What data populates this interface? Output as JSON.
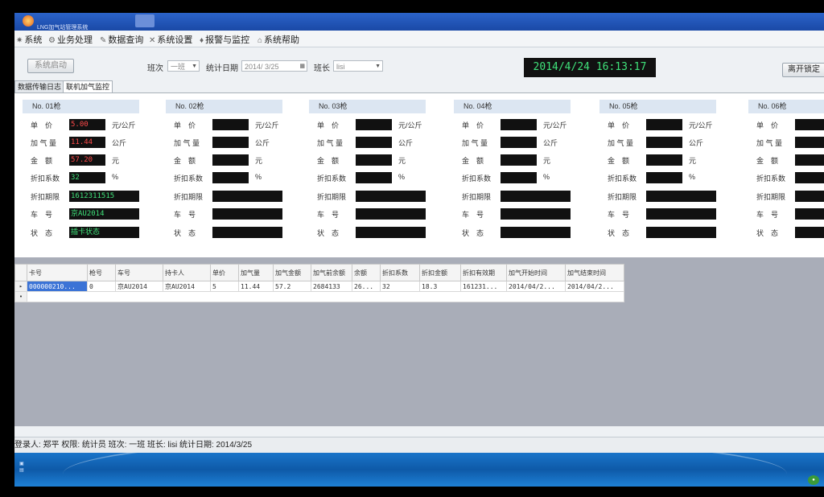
{
  "window": {
    "title": "LNG加气站管理系统"
  },
  "menu": [
    "系统",
    "业务处理",
    "数据查询",
    "系统设置",
    "报警与监控",
    "系统帮助"
  ],
  "menu_icons": [
    "gear-icon",
    "briefcase-icon",
    "search-icon",
    "tools-icon",
    "alarm-icon",
    "help-icon"
  ],
  "toolbar": {
    "start_button": "系统启动",
    "shift_label": "班次",
    "shift_value": "一班",
    "date_label": "统计日期",
    "date_value": "2014/ 3/25",
    "leader_label": "班长",
    "leader_value": "lisi",
    "clock": "2014/4/24  16:13:17",
    "unlock_button": "离开锁定"
  },
  "tabs": [
    "数据传输日志",
    "联机加气监控"
  ],
  "field_labels": [
    "单　价",
    "加 气 量",
    "金　额",
    "折扣系数",
    "折扣期限",
    "车　号",
    "状　态"
  ],
  "units": {
    "price": "元/公斤",
    "qty": "公斤",
    "amount": "元",
    "discount": "%"
  },
  "guns": [
    {
      "name": "No. 01枪",
      "price": "5.00",
      "qty": "11.44",
      "amount": "57.20",
      "discount": "32",
      "period": "1612311515",
      "plate": "京AU2014",
      "status": "插卡状态"
    },
    {
      "name": "No. 02枪",
      "price": "",
      "qty": "",
      "amount": "",
      "discount": "",
      "period": "",
      "plate": "",
      "status": ""
    },
    {
      "name": "No. 03枪",
      "price": "",
      "qty": "",
      "amount": "",
      "discount": "",
      "period": "",
      "plate": "",
      "status": ""
    },
    {
      "name": "No. 04枪",
      "price": "",
      "qty": "",
      "amount": "",
      "discount": "",
      "period": "",
      "plate": "",
      "status": ""
    },
    {
      "name": "No. 05枪",
      "price": "",
      "qty": "",
      "amount": "",
      "discount": "",
      "period": "",
      "plate": "",
      "status": ""
    },
    {
      "name": "No. 06枪",
      "price": "",
      "qty": "",
      "amount": "",
      "discount": "",
      "period": "",
      "plate": "",
      "status": ""
    }
  ],
  "table": {
    "columns": [
      "卡号",
      "枪号",
      "车号",
      "持卡人",
      "单价",
      "加气量",
      "加气金额",
      "加气前余额",
      "余额",
      "折扣系数",
      "折扣金额",
      "折扣有效期",
      "加气开始时间",
      "加气结束时间"
    ],
    "rows": [
      [
        "000000210...",
        "0",
        "京AU2014",
        "京AU2014",
        "5",
        "11.44",
        "57.2",
        "2684133",
        "26...",
        "32",
        "18.3",
        "161231...",
        "2014/04/2...",
        "2014/04/2..."
      ]
    ]
  },
  "status": {
    "text": "登录人: 郑平  权限: 统计员  班次: 一班  班长: lisi  统计日期: 2014/3/25"
  },
  "colors": {
    "led_red": "#ff4a4a",
    "led_green": "#3fe27a",
    "selection": "#3b73d6"
  }
}
